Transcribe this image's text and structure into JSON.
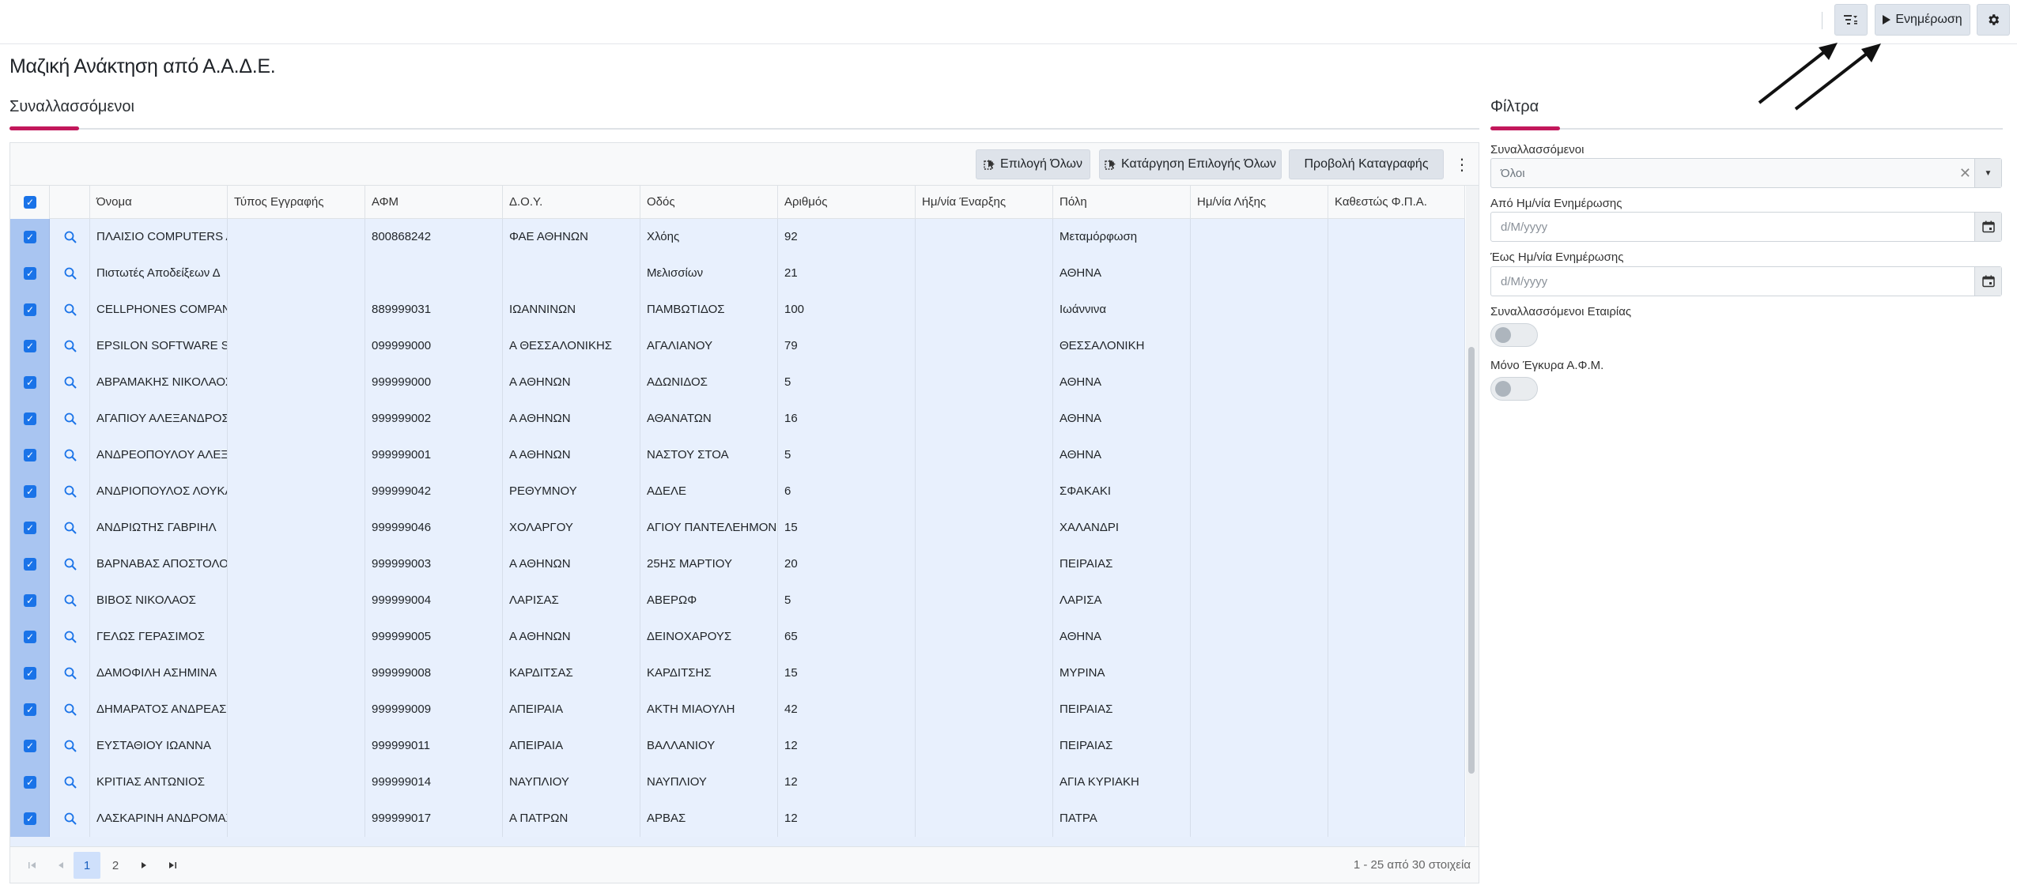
{
  "topbar": {
    "update_label": "Ενημέρωση",
    "filter_icon": "filter-list-icon",
    "play_icon": "play-icon",
    "settings_icon": "gear-icon"
  },
  "page": {
    "title": "Μαζική Ανάκτηση από Α.Α.Δ.Ε.",
    "section_left": "Συναλλασσόμενοι",
    "section_right": "Φίλτρα"
  },
  "grid_toolbar": {
    "select_all": "Επιλογή Όλων",
    "deselect_all": "Κατάργηση Επιλογής Όλων",
    "view_record": "Προβολή Καταγραφής"
  },
  "columns": [
    "Όνομα",
    "Τύπος Εγγραφής",
    "ΑΦΜ",
    "Δ.Ο.Υ.",
    "Οδός",
    "Αριθμός",
    "Ημ/νία Έναρξης",
    "Πόλη",
    "Ημ/νία Λήξης",
    "Καθεστώς Φ.Π.Α."
  ],
  "rows": [
    [
      "ΠΛΑΙΣΙΟ COMPUTERS AE",
      "",
      "800868242",
      "ΦΑΕ ΑΘΗΝΩΝ",
      "Χλόης",
      "92",
      "",
      "Μεταμόρφωση",
      "",
      ""
    ],
    [
      "Πιστωτές Αποδείξεων Δ",
      "",
      "",
      "",
      "Μελισσίων",
      "21",
      "",
      "ΑΘΗΝΑ",
      "",
      ""
    ],
    [
      "CELLPHONES COMPANY",
      "",
      "889999031",
      "ΙΩΑΝΝΙΝΩΝ",
      "ΠΑΜΒΩΤΙΔΟΣ",
      "100",
      "",
      "Ιωάννινα",
      "",
      ""
    ],
    [
      "EPSILON SOFTWARE SA",
      "",
      "099999000",
      "Α ΘΕΣΣΑΛΟΝΙΚΗΣ",
      "ΑΓΑΛΙΑΝΟΥ",
      "79",
      "",
      "ΘΕΣΣΑΛΟΝΙΚΗ",
      "",
      ""
    ],
    [
      "ΑΒΡΑΜΑΚΗΣ ΝΙΚΟΛΑΟΣ",
      "",
      "999999000",
      "Α ΑΘΗΝΩΝ",
      "ΑΔΩΝΙΔΟΣ",
      "5",
      "",
      "ΑΘΗΝΑ",
      "",
      ""
    ],
    [
      "ΑΓΑΠΙΟΥ ΑΛΕΞΑΝΔΡΟΣ",
      "",
      "999999002",
      "Α ΑΘΗΝΩΝ",
      "ΑΘΑΝΑΤΩΝ",
      "16",
      "",
      "ΑΘΗΝΑ",
      "",
      ""
    ],
    [
      "ΑΝΔΡΕΟΠΟΥΛΟΥ ΑΛΕΞΑ",
      "",
      "999999001",
      "Α ΑΘΗΝΩΝ",
      "ΝΑΣΤΟΥ ΣΤΟΑ",
      "5",
      "",
      "ΑΘΗΝΑ",
      "",
      ""
    ],
    [
      "ΑΝΔΡΙΟΠΟΥΛΟΣ ΛΟΥΚΑ",
      "",
      "999999042",
      "ΡΕΘΥΜΝΟΥ",
      "ΑΔΕΛΕ",
      "6",
      "",
      "ΣΦΑΚΑΚΙ",
      "",
      ""
    ],
    [
      "ΑΝΔΡΙΩΤΗΣ ΓΑΒΡΙΗΛ",
      "",
      "999999046",
      "ΧΟΛΑΡΓΟΥ",
      "ΑΓΙΟΥ ΠΑΝΤΕΛΕΗΜΟΝΟΣ",
      "15",
      "",
      "ΧΑΛΑΝΔΡΙ",
      "",
      ""
    ],
    [
      "ΒΑΡΝΑΒΑΣ ΑΠΟΣΤΟΛΟΣ",
      "",
      "999999003",
      "Α ΑΘΗΝΩΝ",
      "25ΗΣ ΜΑΡΤΙΟΥ",
      "20",
      "",
      "ΠΕΙΡΑΙΑΣ",
      "",
      ""
    ],
    [
      "ΒΙΒΟΣ ΝΙΚΟΛΑΟΣ",
      "",
      "999999004",
      "ΛΑΡΙΣΑΣ",
      "ΑΒΕΡΩΦ",
      "5",
      "",
      "ΛΑΡΙΣΑ",
      "",
      ""
    ],
    [
      "ΓΕΛΩΣ ΓΕΡΑΣΙΜΟΣ",
      "",
      "999999005",
      "Α ΑΘΗΝΩΝ",
      "ΔΕΙΝΟΧΑΡΟΥΣ",
      "65",
      "",
      "ΑΘΗΝΑ",
      "",
      ""
    ],
    [
      "ΔΑΜΟΦΙΛΗ ΑΣΗΜΙΝΑ",
      "",
      "999999008",
      "ΚΑΡΔΙΤΣΑΣ",
      "ΚΑΡΔΙΤΣΗΣ",
      "15",
      "",
      "ΜΥΡΙΝΑ",
      "",
      ""
    ],
    [
      "ΔΗΜΑΡΑΤΟΣ ΑΝΔΡΕΑΣ",
      "",
      "999999009",
      "ΑΠΕΙΡΑΙΑ",
      "ΑΚΤΗ ΜΙΑΟΥΛΗ",
      "42",
      "",
      "ΠΕΙΡΑΙΑΣ",
      "",
      ""
    ],
    [
      "ΕΥΣΤΑΘΙΟΥ ΙΩΑΝΝΑ",
      "",
      "999999011",
      "ΑΠΕΙΡΑΙΑ",
      "ΒΑΛΛΑΝΙΟΥ",
      "12",
      "",
      "ΠΕΙΡΑΙΑΣ",
      "",
      ""
    ],
    [
      "ΚΡΙΤΙΑΣ ΑΝΤΩΝΙΟΣ",
      "",
      "999999014",
      "ΝΑΥΠΛΙΟΥ",
      "ΝΑΥΠΛΙΟΥ",
      "12",
      "",
      "ΑΓΙΑ ΚΥΡΙΑΚΗ",
      "",
      ""
    ],
    [
      "ΛΑΣΚΑΡΙΝΗ ΑΝΔΡΟΜΑΧ",
      "",
      "999999017",
      "Α ΠΑΤΡΩΝ",
      "ΑΡΒΑΣ",
      "12",
      "",
      "ΠΑΤΡΑ",
      "",
      ""
    ]
  ],
  "pager": {
    "pages": [
      "1",
      "2"
    ],
    "info": "1 - 25 από 30 στοιχεία"
  },
  "filters": {
    "counterparties_label": "Συναλλασσόμενοι",
    "counterparties_value": "Όλοι",
    "from_date_label": "Από Ημ/νία Ενημέρωσης",
    "to_date_label": "Έως Ημ/νία Ενημέρωσης",
    "date_placeholder": "d/M/yyyy",
    "company_label": "Συναλλασσόμενοι Εταιρίας",
    "valid_vat_label": "Μόνο Έγκυρα Α.Φ.Μ."
  },
  "colors": {
    "accent": "#c2185b",
    "primary": "#1a73e8",
    "row_selected": "#e8f0fd"
  }
}
